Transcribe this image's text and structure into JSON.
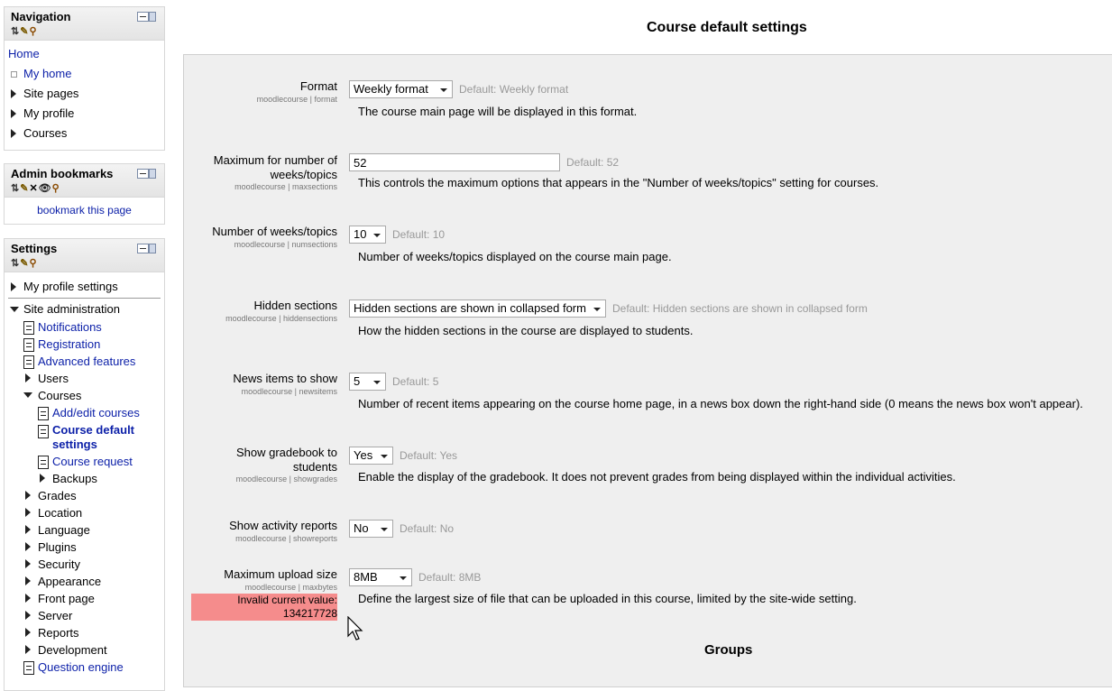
{
  "navigation": {
    "title": "Navigation",
    "home": "Home",
    "items": [
      "My home",
      "Site pages",
      "My profile",
      "Courses"
    ]
  },
  "admin_bookmarks": {
    "title": "Admin bookmarks",
    "link": "bookmark this page"
  },
  "settings_block": {
    "title": "Settings",
    "my_profile_settings": "My profile settings",
    "site_administration": "Site administration",
    "items": {
      "notifications": "Notifications",
      "registration": "Registration",
      "advanced_features": "Advanced features",
      "users": "Users",
      "courses": "Courses",
      "add_edit_courses": "Add/edit courses",
      "course_default_settings_1": "Course default",
      "course_default_settings_2": "settings",
      "course_request": "Course request",
      "backups": "Backups",
      "grades": "Grades",
      "location": "Location",
      "language": "Language",
      "plugins": "Plugins",
      "security": "Security",
      "appearance": "Appearance",
      "front_page": "Front page",
      "server": "Server",
      "reports": "Reports",
      "development": "Development",
      "question_engine": "Question engine"
    }
  },
  "page": {
    "title": "Course default settings",
    "groups_heading": "Groups"
  },
  "settings": {
    "format": {
      "label": "Format",
      "name": "moodlecourse | format",
      "value": "Weekly format",
      "default": "Default: Weekly format",
      "description": "The course main page will be displayed in this format."
    },
    "maxsections": {
      "label_1": "Maximum for number of",
      "label_2": "weeks/topics",
      "name": "moodlecourse | maxsections",
      "value": "52",
      "default": "Default: 52",
      "description": "This controls the maximum options that appears in the \"Number of weeks/topics\" setting for courses."
    },
    "numsections": {
      "label": "Number of weeks/topics",
      "name": "moodlecourse | numsections",
      "value": "10",
      "default": "Default: 10",
      "description": "Number of weeks/topics displayed on the course main page."
    },
    "hiddensections": {
      "label": "Hidden sections",
      "name": "moodlecourse | hiddensections",
      "value": "Hidden sections are shown in collapsed form",
      "default": "Default: Hidden sections are shown in collapsed form",
      "description": "How the hidden sections in the course are displayed to students."
    },
    "newsitems": {
      "label": "News items to show",
      "name": "moodlecourse | newsitems",
      "value": "5",
      "default": "Default: 5",
      "description": "Number of recent items appearing on the course home page, in a news box down the right-hand side (0 means the news box won't appear)."
    },
    "showgrades": {
      "label_1": "Show gradebook to",
      "label_2": "students",
      "name": "moodlecourse | showgrades",
      "value": "Yes",
      "default": "Default: Yes",
      "description": "Enable the display of the gradebook. It does not prevent grades from being displayed within the individual activities."
    },
    "showreports": {
      "label": "Show activity reports",
      "name": "moodlecourse | showreports",
      "value": "No",
      "default": "Default: No"
    },
    "maxbytes": {
      "label": "Maximum upload size",
      "name": "moodlecourse | maxbytes",
      "value": "8MB",
      "default": "Default: 8MB",
      "invalid_1": "Invalid current value:",
      "invalid_2": "134217728",
      "description": "Define the largest size of file that can be uploaded in this course, limited by the site-wide setting."
    }
  }
}
